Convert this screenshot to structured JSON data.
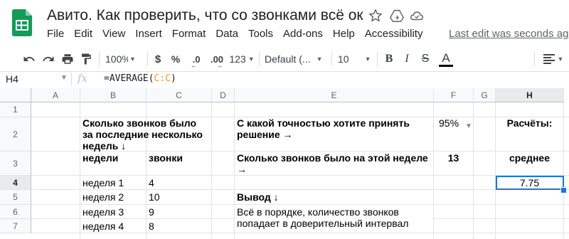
{
  "app": {
    "doc_title": "Авито. Как проверить, что со звонками всё ок",
    "menu": [
      "File",
      "Edit",
      "View",
      "Insert",
      "Format",
      "Data",
      "Tools",
      "Add-ons",
      "Help",
      "Accessibility"
    ],
    "last_edit": "Last edit was seconds ago",
    "accent_color": "#1a73e8",
    "logo_color": "#0f9d58"
  },
  "toolbar": {
    "zoom": "100%",
    "currency": "$",
    "percent": "%",
    "decrease_decimals": ".0",
    "increase_decimals": ".00",
    "more_formats": "123",
    "font": "Default (...",
    "font_size": "10",
    "bold": "B",
    "italic": "I",
    "strikethrough": "S",
    "text_color_letter": "A"
  },
  "formula_bar": {
    "name_box": "H4",
    "fx": "fx",
    "formula_prefix": "=AVERAGE(",
    "formula_ref": "C:C",
    "formula_suffix": ")"
  },
  "grid": {
    "columns": [
      "A",
      "B",
      "C",
      "D",
      "E",
      "F",
      "G",
      "H"
    ],
    "rows": [
      "1",
      "2",
      "3",
      "4",
      "5",
      "6",
      "7"
    ],
    "selected_cell": "H4",
    "cells": {
      "B2": "Сколько звонков было за последние несколько недель ↓",
      "E2": "С какой точностью хотите принять решение →",
      "F2": "95%",
      "H2": "Расчёты:",
      "B3": "недели",
      "C3": "звонки",
      "E3": "Сколько звонков было на этой неделе →",
      "F3": "13",
      "H3": "среднее",
      "B4": "неделя 1",
      "C4": "4",
      "H4": "7.75",
      "B5": "неделя 2",
      "C5": "10",
      "E5": "Вывод ↓",
      "B6": "неделя 3",
      "C6": "9",
      "E6": "Всё в порядке, количество звонков попадает в доверительный интервал",
      "B7": "неделя 4",
      "C7": "8"
    }
  }
}
